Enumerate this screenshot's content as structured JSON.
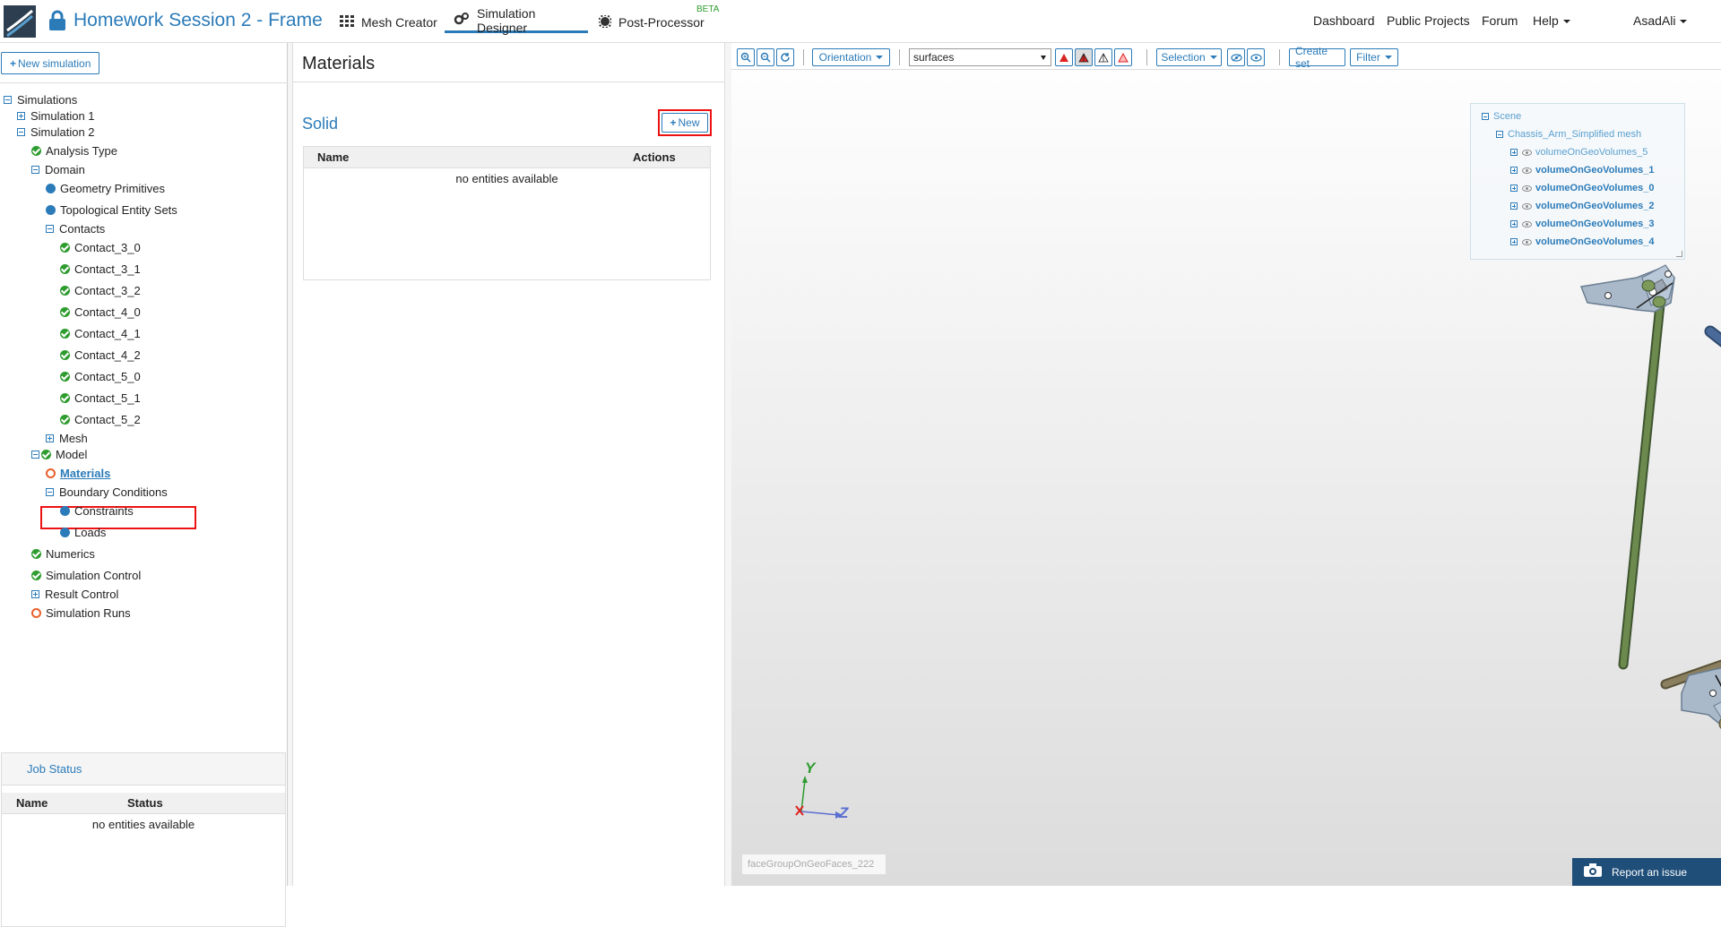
{
  "app": {
    "project_title": "Homework Session 2 - Frame",
    "nav": {
      "mesh_creator": "Mesh Creator",
      "simulation_designer": "Simulation Designer",
      "post_processor": "Post-Processor",
      "beta_badge": "BETA"
    },
    "right_links": {
      "dashboard": "Dashboard",
      "public_projects": "Public Projects",
      "forum": "Forum",
      "help": "Help",
      "user": "AsadAli"
    }
  },
  "left_panel": {
    "new_simulation": "New simulation",
    "tree": {
      "simulations": "Simulations",
      "simulation1": "Simulation 1",
      "simulation2": "Simulation 2",
      "analysis_type": "Analysis Type",
      "domain": "Domain",
      "geometry_primitives": "Geometry Primitives",
      "topological_entity_sets": "Topological Entity Sets",
      "contacts": "Contacts",
      "contact_items": [
        "Contact_3_0",
        "Contact_3_1",
        "Contact_3_2",
        "Contact_4_0",
        "Contact_4_1",
        "Contact_4_2",
        "Contact_5_0",
        "Contact_5_1",
        "Contact_5_2"
      ],
      "mesh": "Mesh",
      "model": "Model",
      "materials": "Materials",
      "boundary_conditions": "Boundary Conditions",
      "constraints": "Constraints",
      "loads": "Loads",
      "numerics": "Numerics",
      "simulation_control": "Simulation Control",
      "result_control": "Result Control",
      "simulation_runs": "Simulation Runs"
    },
    "job_status": {
      "title": "Job Status",
      "col_name": "Name",
      "col_status": "Status",
      "empty": "no entities available"
    }
  },
  "materials_panel": {
    "title": "Materials",
    "section": "Solid",
    "new_button": "New",
    "col_name": "Name",
    "col_actions": "Actions",
    "empty": "no entities available"
  },
  "viewer": {
    "toolbar": {
      "orientation": "Orientation",
      "render_mode": "surfaces",
      "selection": "Selection",
      "create_set": "Create set",
      "filter": "Filter"
    },
    "scene_tree": {
      "scene": "Scene",
      "mesh": "Chassis_Arm_Simplified mesh",
      "volumes": [
        "volumeOnGeoVolumes_5",
        "volumeOnGeoVolumes_1",
        "volumeOnGeoVolumes_0",
        "volumeOnGeoVolumes_2",
        "volumeOnGeoVolumes_3",
        "volumeOnGeoVolumes_4"
      ]
    },
    "axes": {
      "y": "Y",
      "z": "Z"
    },
    "hover_field": "faceGroupOnGeoFaces_222",
    "report_issue": "Report an issue"
  },
  "colors": {
    "accent": "#2b7bb9",
    "ok": "#2e9c2e",
    "pending": "#e8602c",
    "highlight": "#e11111",
    "rod_green": "#6d8a4e",
    "rod_blue": "#4a6b9a",
    "rod_olive": "#8a8060"
  }
}
